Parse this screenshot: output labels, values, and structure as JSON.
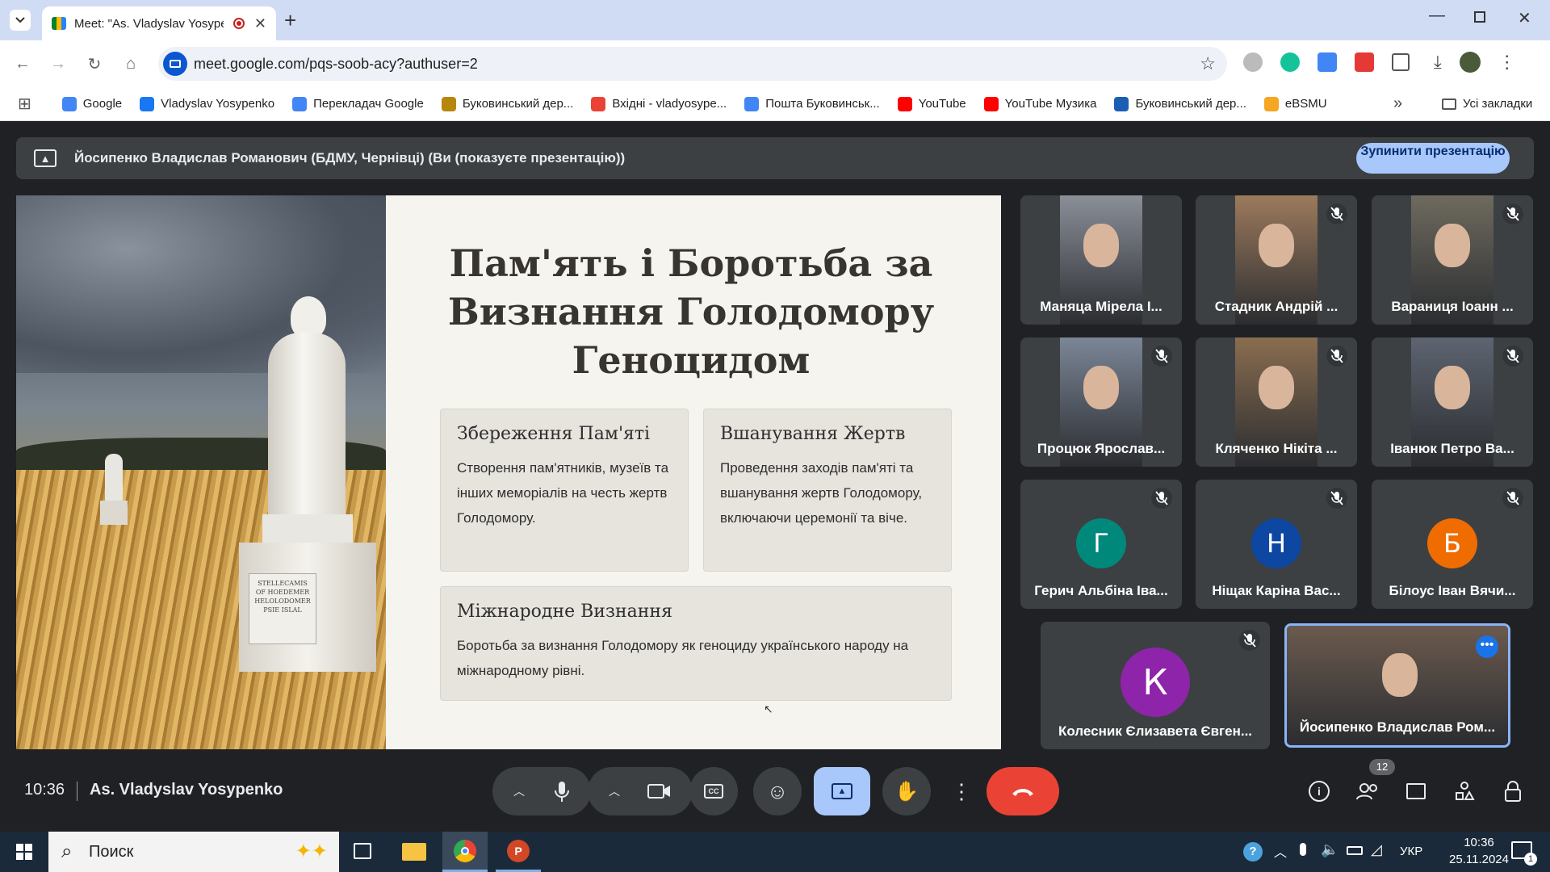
{
  "browser": {
    "tab_title": "Meet: \"As. Vladyslav Yosype",
    "url": "meet.google.com/pqs-soob-acy?authuser=2",
    "bookmarks": [
      {
        "label": "Google",
        "icon": "google-icon",
        "color": "#4285f4"
      },
      {
        "label": "Vladyslav Yosypenko",
        "icon": "facebook-icon",
        "color": "#1877f2"
      },
      {
        "label": "Перекладач Google",
        "icon": "translate-icon",
        "color": "#4285f4"
      },
      {
        "label": "Буковинський дер...",
        "icon": "crest-icon",
        "color": "#b8860b"
      },
      {
        "label": "Вхідні - vladyosype...",
        "icon": "gmail-icon",
        "color": "#ea4335"
      },
      {
        "label": "Пошта Буковинськ...",
        "icon": "google-icon",
        "color": "#4285f4"
      },
      {
        "label": "YouTube",
        "icon": "youtube-icon",
        "color": "#ff0000"
      },
      {
        "label": "YouTube Музика",
        "icon": "youtube-music-icon",
        "color": "#ff0000"
      },
      {
        "label": "Буковинський дер...",
        "icon": "building-icon",
        "color": "#1a5fb4"
      },
      {
        "label": "eBSMU",
        "icon": "ebsmu-icon",
        "color": "#f5a623"
      }
    ],
    "all_bookmarks_label": "Усі закладки"
  },
  "meet": {
    "banner_text": "Йосипенко Владислав Романович (БДМУ, Чернівці) (Ви (показуєте презентацію))",
    "stop_button": "Зупинити презентацію",
    "slide": {
      "title": "Пам'ять і Боротьба за Визнання Голодомору Геноцидом",
      "plaque": "STELLECAMIS OF HOEDEMER HELOLODOMER PSIE ISLAL",
      "cards": [
        {
          "heading": "Збереження Пам'яті",
          "text": "Створення пам'ятників, музеїв та інших меморіалів на честь жертв Голодомору."
        },
        {
          "heading": "Вшанування Жертв",
          "text": "Проведення заходів пам'яті та вшанування жертв Голодомору, включаючи церемонії та віче."
        },
        {
          "heading": "Міжнародне Визнання",
          "text": "Боротьба за визнання Голодомору як геноциду українського народу на міжнародному рівні."
        }
      ]
    },
    "participants": [
      {
        "name": "Маняца Мірела І...",
        "type": "video",
        "muted": false,
        "bg": "#8a8f98"
      },
      {
        "name": "Стадник Андрій ...",
        "type": "video",
        "muted": true,
        "bg": "#9c7a5c"
      },
      {
        "name": "Вараниця Іоанн ...",
        "type": "video",
        "muted": true,
        "bg": "#6e6a5e"
      },
      {
        "name": "Процюк Ярослав...",
        "type": "video",
        "muted": true,
        "bg": "#7b8696"
      },
      {
        "name": "Кляченко Нікіта ...",
        "type": "video",
        "muted": true,
        "bg": "#8a6d4f"
      },
      {
        "name": "Іванюк Петро Ва...",
        "type": "video",
        "muted": true,
        "bg": "#5d6470"
      },
      {
        "name": "Герич Альбіна Іва...",
        "type": "avatar",
        "letter": "Г",
        "color": "#00897b",
        "muted": true
      },
      {
        "name": "Ніщак Каріна Вас...",
        "type": "avatar",
        "letter": "Н",
        "color": "#0d47a1",
        "muted": true
      },
      {
        "name": "Білоус Іван Вячи...",
        "type": "avatar",
        "letter": "Б",
        "color": "#ef6c00",
        "muted": true
      },
      {
        "name": "Колесник Єлизавета Євген...",
        "type": "avatar",
        "letter": "К",
        "color": "#8e24aa",
        "muted": true
      },
      {
        "name": "Йосипенко Владислав Ром...",
        "type": "video",
        "muted": false,
        "bg": "#6b5a4e",
        "self": true
      }
    ],
    "time": "10:36",
    "meeting_name": "As. Vladyslav Yosypenko",
    "people_count": "12",
    "accent_red": "#ea4335",
    "accent_blue": "#a8c7fa"
  },
  "taskbar": {
    "search_placeholder": "Поиск",
    "lang": "УКР",
    "clock_time": "10:36",
    "clock_date": "25.11.2024",
    "notifications": "1"
  }
}
